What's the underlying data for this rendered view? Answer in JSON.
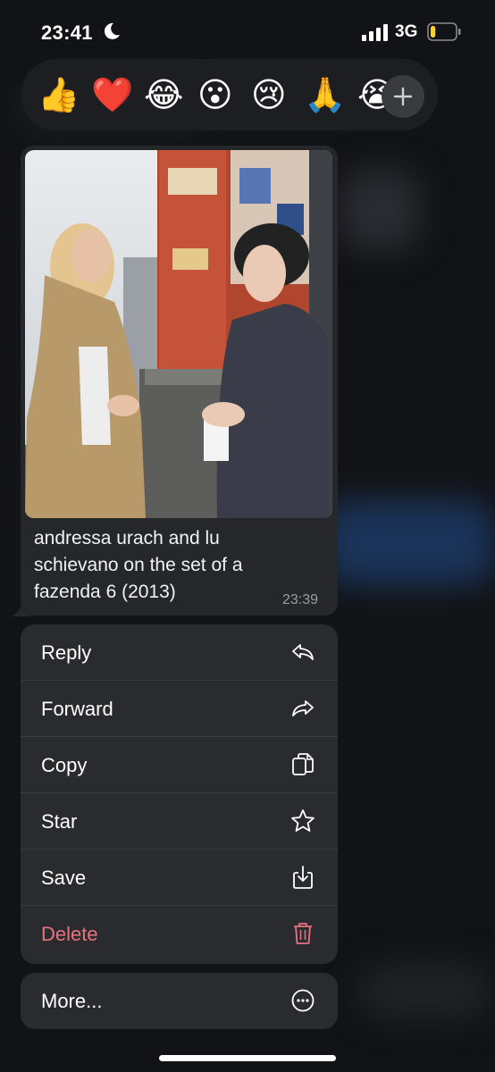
{
  "status_bar": {
    "time": "23:41",
    "network": "3G",
    "battery_level": 0.2
  },
  "reactions": {
    "emojis": [
      {
        "name": "thumbs-up",
        "glyph": "👍"
      },
      {
        "name": "red-heart",
        "glyph": "❤️"
      },
      {
        "name": "tears-of-joy",
        "glyph": "😂"
      },
      {
        "name": "surprised",
        "glyph": "😮"
      },
      {
        "name": "crying",
        "glyph": "😢"
      },
      {
        "name": "folded-hands",
        "glyph": "🙏"
      },
      {
        "name": "loudly-crying",
        "glyph": "😭"
      }
    ],
    "more_icon": "plus-icon"
  },
  "message": {
    "caption": "andressa urach and lu schievano on the set of a fazenda 6 (2013)",
    "time": "23:39"
  },
  "menu": {
    "items": [
      {
        "label": "Reply",
        "icon": "reply-icon"
      },
      {
        "label": "Forward",
        "icon": "forward-icon"
      },
      {
        "label": "Copy",
        "icon": "copy-icon"
      },
      {
        "label": "Star",
        "icon": "star-icon"
      },
      {
        "label": "Save",
        "icon": "save-icon"
      },
      {
        "label": "Delete",
        "icon": "trash-icon"
      }
    ],
    "more": {
      "label": "More...",
      "icon": "more-icon"
    }
  },
  "colors": {
    "danger": "#e8737c",
    "menu_bg": "#2a2b2f",
    "bubble_bg": "#26272b"
  }
}
